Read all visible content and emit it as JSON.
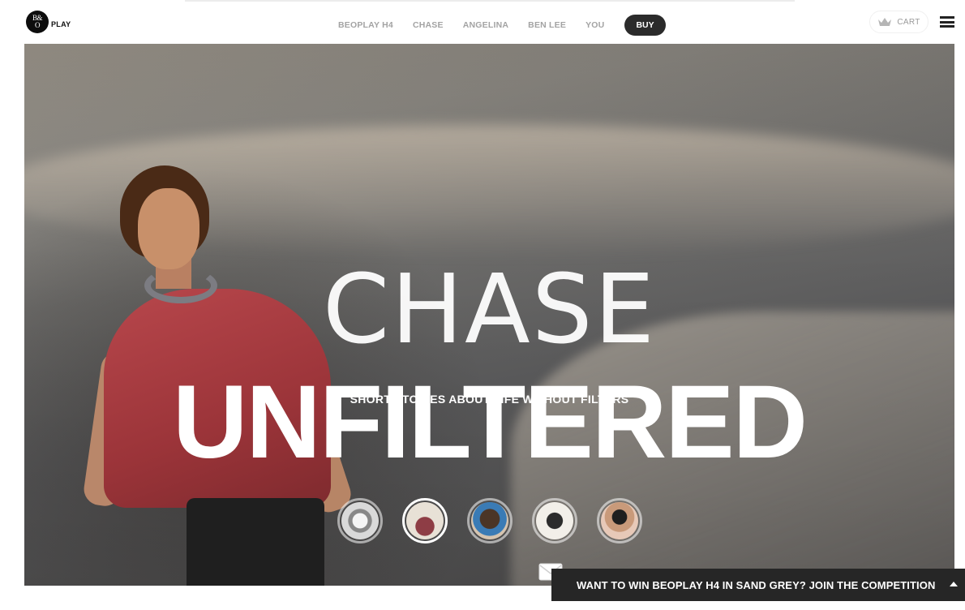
{
  "header": {
    "logo": {
      "mark_top": "B&",
      "mark_bottom": "O",
      "text": "PLAY"
    },
    "nav": [
      {
        "label": "BEOPLAY H4"
      },
      {
        "label": "CHASE"
      },
      {
        "label": "ANGELINA"
      },
      {
        "label": "BEN LEE"
      },
      {
        "label": "YOU"
      }
    ],
    "buy_label": "BUY",
    "cart_label": "CART",
    "cart_icon": "crown-cart-icon",
    "menu_icon": "hamburger-menu-icon"
  },
  "hero": {
    "title_line1": "CHASE",
    "title_line2": "UNFILTERED",
    "subtitle": "SHORT STORIES ABOUT LIFE WITHOUT FILTERS",
    "thumbnails": [
      {
        "name": "headphones-thumb",
        "active": false
      },
      {
        "name": "chase-thumb",
        "active": true
      },
      {
        "name": "angelina-thumb",
        "active": false
      },
      {
        "name": "ben-lee-thumb",
        "active": false
      },
      {
        "name": "you-thumb",
        "active": false
      }
    ]
  },
  "competition": {
    "text": "WANT TO WIN BEOPLAY H4 IN SAND GREY?  JOIN THE COMPETITION",
    "arrow_icon": "caret-up-icon",
    "mail_icon": "envelope-icon"
  },
  "colors": {
    "header_bg": "#ffffff",
    "nav_text": "#a3a3a3",
    "buy_bg": "#2b2b2b",
    "competition_bg": "#262626",
    "hero_text": "#ffffff"
  }
}
